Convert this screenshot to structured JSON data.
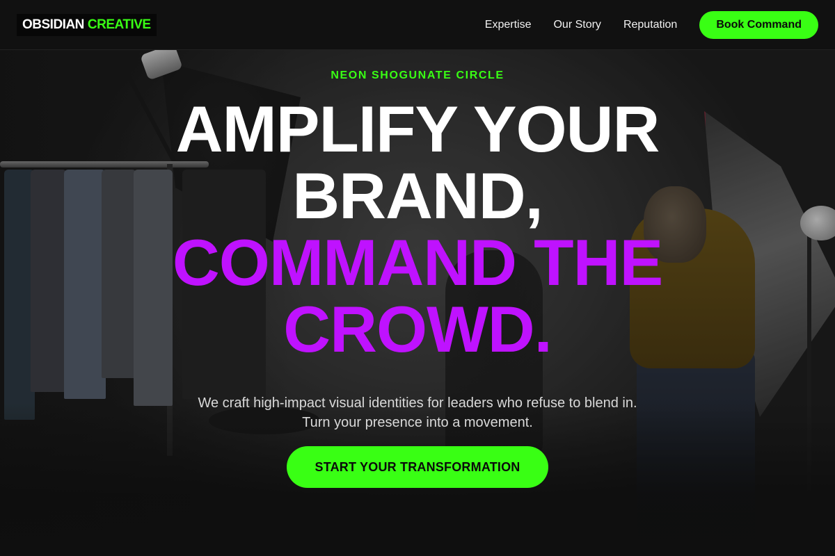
{
  "header": {
    "logo_primary": "OBSIDIAN",
    "logo_accent": "CREATIVE",
    "nav": [
      {
        "label": "Expertise"
      },
      {
        "label": "Our Story"
      },
      {
        "label": "Reputation"
      }
    ],
    "cta_label": "Book Command"
  },
  "hero": {
    "eyebrow": "NEON SHOGUNATE CIRCLE",
    "headline_lines": [
      {
        "text": "AMPLIFY YOUR",
        "color": "white"
      },
      {
        "text": "BRAND,",
        "color": "white"
      },
      {
        "text": "COMMAND THE",
        "color": "purple"
      },
      {
        "text": "CROWD.",
        "color": "purple"
      }
    ],
    "subtext": "We craft high-impact visual identities for leaders who refuse to blend in. Turn your presence into a movement.",
    "cta_label": "START YOUR TRANSFORMATION"
  },
  "colors": {
    "accent_green": "#39ff14",
    "accent_purple": "#bf12ff",
    "header_bg": "#111111"
  }
}
